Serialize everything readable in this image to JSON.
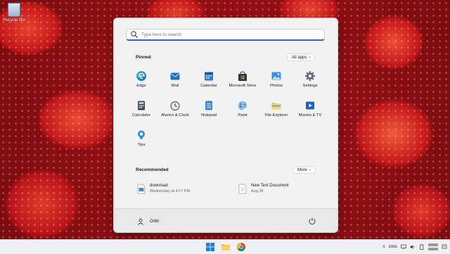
{
  "desktop": {
    "recycle_bin_label": "Recycle Bin"
  },
  "start_menu": {
    "search_placeholder": "Type here to search",
    "pinned_title": "Pinned",
    "all_apps_label": "All apps",
    "pinned_apps": [
      {
        "label": "Edge",
        "icon": "edge-icon"
      },
      {
        "label": "Mail",
        "icon": "mail-icon"
      },
      {
        "label": "Calendar",
        "icon": "calendar-icon"
      },
      {
        "label": "Microsoft Store",
        "icon": "store-icon"
      },
      {
        "label": "Photos",
        "icon": "photos-icon"
      },
      {
        "label": "Settings",
        "icon": "gear-icon"
      },
      {
        "label": "Calculator",
        "icon": "calculator-icon"
      },
      {
        "label": "Alarms & Clock",
        "icon": "clock-icon"
      },
      {
        "label": "Notepad",
        "icon": "notepad-icon"
      },
      {
        "label": "Paint",
        "icon": "paint-icon"
      },
      {
        "label": "File Explorer",
        "icon": "folder-icon"
      },
      {
        "label": "Movies & TV",
        "icon": "movies-icon"
      },
      {
        "label": "Tips",
        "icon": "tips-icon"
      }
    ],
    "recommended_title": "Recommended",
    "more_label": "More",
    "recommended": [
      {
        "name": "download",
        "time": "Wednesday at 4:17 PM"
      },
      {
        "name": "New Text Document",
        "time": "Aug 28"
      }
    ],
    "user_name": "Orbit"
  },
  "taskbar": {
    "apps": [
      "windows-start-icon",
      "file-explorer-icon",
      "chrome-icon"
    ],
    "language": "ENG"
  },
  "colors": {
    "accent": "#2b64c4",
    "menu_bg": "#f2f2f2",
    "taskbar_bg": "#eef0f3"
  }
}
